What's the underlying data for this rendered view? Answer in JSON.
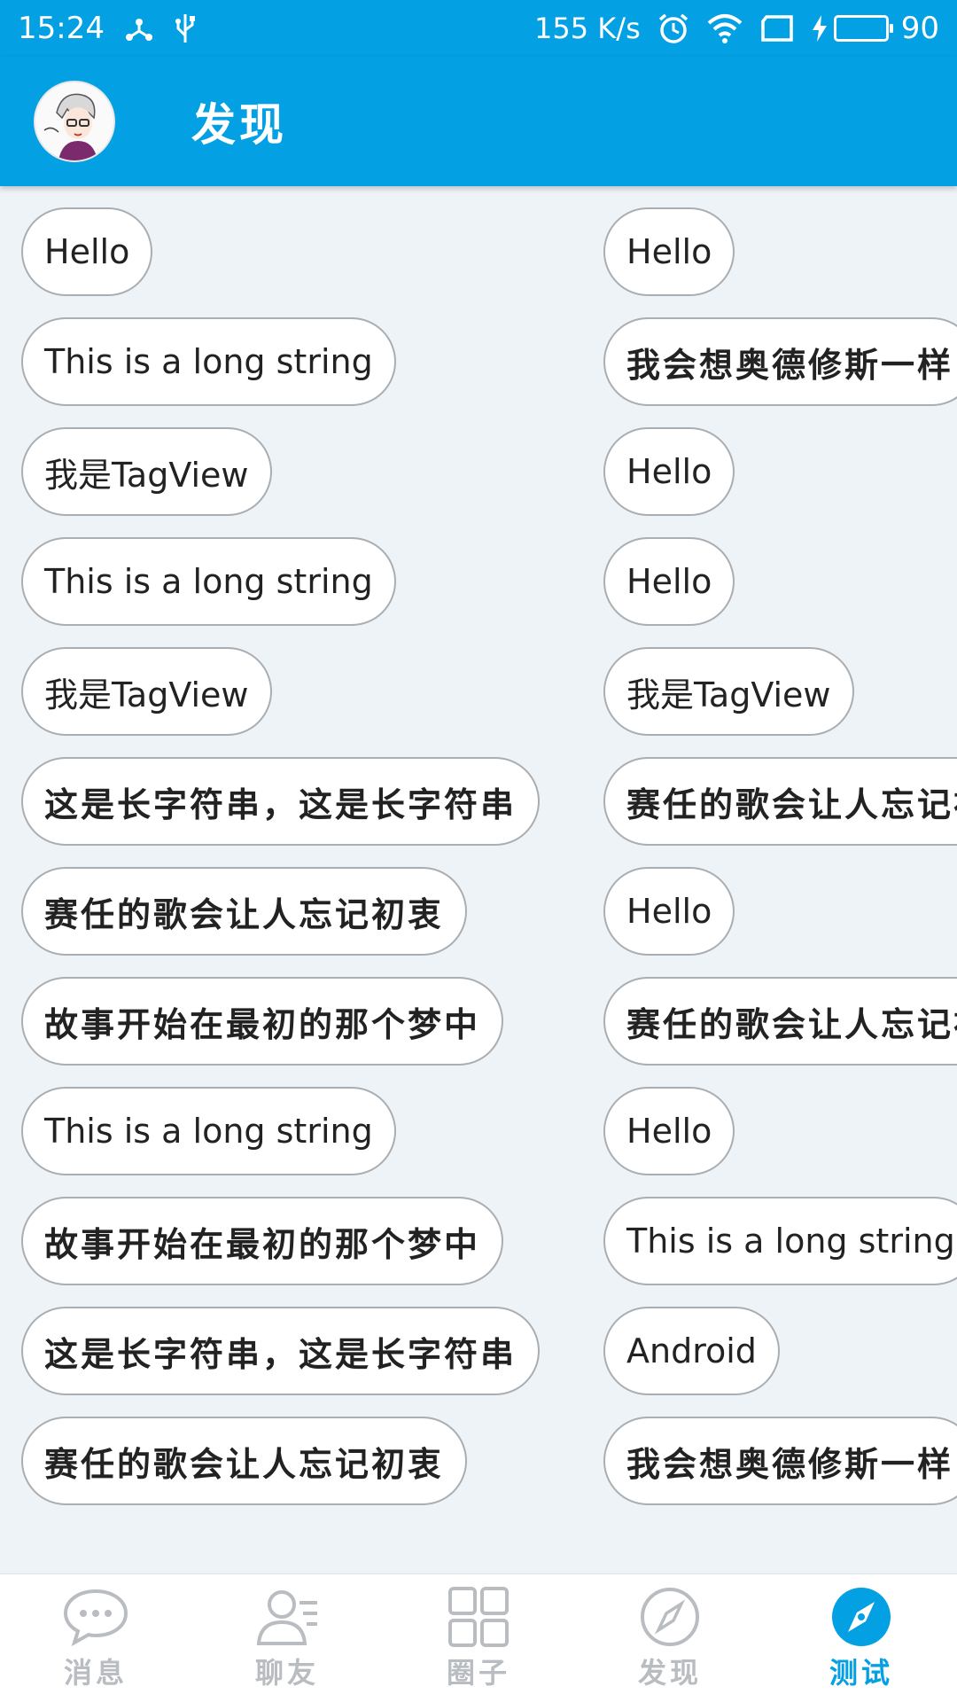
{
  "status_bar": {
    "time": "15:24",
    "net_speed": "155 K/s",
    "battery": "90"
  },
  "app_bar": {
    "title": "发现"
  },
  "tags": {
    "left": [
      {
        "text": "Hello",
        "cjk": false
      },
      {
        "text": "This is a long string",
        "cjk": false
      },
      {
        "text": "我是TagView",
        "cjk": false
      },
      {
        "text": "This is a long string",
        "cjk": false
      },
      {
        "text": "我是TagView",
        "cjk": false
      },
      {
        "text": "这是长字符串，这是长字符串",
        "cjk": true
      },
      {
        "text": "赛任的歌会让人忘记初衷",
        "cjk": true
      },
      {
        "text": "故事开始在最初的那个梦中",
        "cjk": true
      },
      {
        "text": "This is a long string",
        "cjk": false
      },
      {
        "text": "故事开始在最初的那个梦中",
        "cjk": true
      },
      {
        "text": "这是长字符串，这是长字符串",
        "cjk": true
      },
      {
        "text": "赛任的歌会让人忘记初衷",
        "cjk": true
      }
    ],
    "right": [
      {
        "text": "Hello",
        "cjk": false
      },
      {
        "text": "我会想奥德修斯一样",
        "cjk": true
      },
      {
        "text": "Hello",
        "cjk": false
      },
      {
        "text": "Hello",
        "cjk": false
      },
      {
        "text": "我是TagView",
        "cjk": false
      },
      {
        "text": "赛任的歌会让人忘记初衷",
        "cjk": true
      },
      {
        "text": "Hello",
        "cjk": false
      },
      {
        "text": "赛任的歌会让人忘记初衷",
        "cjk": true
      },
      {
        "text": "Hello",
        "cjk": false
      },
      {
        "text": "This is a long string",
        "cjk": false
      },
      {
        "text": "Android",
        "cjk": false
      },
      {
        "text": "我会想奥德修斯一样",
        "cjk": true
      }
    ]
  },
  "bottom_nav": {
    "items": [
      {
        "label": "消息",
        "icon": "message-icon"
      },
      {
        "label": "聊友",
        "icon": "contacts-icon"
      },
      {
        "label": "圈子",
        "icon": "grid-icon"
      },
      {
        "label": "发现",
        "icon": "compass-icon"
      },
      {
        "label": "测试",
        "icon": "compass-filled-icon"
      }
    ],
    "active_index": 4
  },
  "colors": {
    "primary": "#03a0e3",
    "inactive": "#b9bdc1",
    "battery_fill": "#2ee07a"
  }
}
